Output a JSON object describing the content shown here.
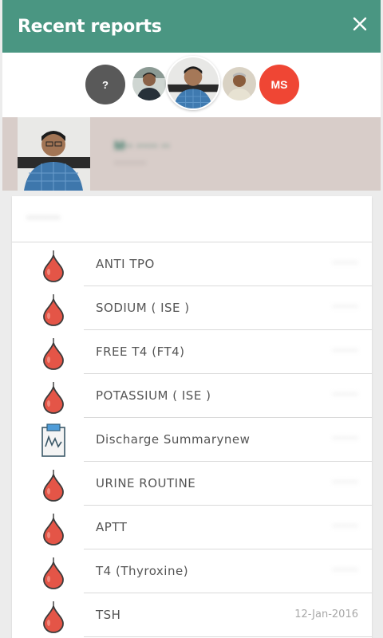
{
  "header": {
    "title": "Recent reports"
  },
  "avatars": [
    {
      "initials": "?",
      "color": "#595959"
    },
    {
      "initials": "",
      "color": "#6b7a80"
    },
    {
      "initials": "",
      "color": "#88aab6"
    },
    {
      "initials": "",
      "color": "#7d8480"
    },
    {
      "initials": "MS",
      "color": "#ef4634"
    }
  ],
  "profile": {
    "name": "M·· ····· ··",
    "sub": "········"
  },
  "card": {
    "group": "········"
  },
  "reports": [
    {
      "label": "ANTI TPO",
      "date": "········",
      "icon": "blood-drop-icon"
    },
    {
      "label": "SODIUM ( ISE )",
      "date": "········",
      "icon": "blood-drop-icon"
    },
    {
      "label": "FREE T4 (FT4)",
      "date": "········",
      "icon": "blood-drop-icon"
    },
    {
      "label": "POTASSIUM ( ISE )",
      "date": "········",
      "icon": "blood-drop-icon"
    },
    {
      "label": "Discharge Summarynew",
      "date": "········",
      "icon": "clipboard-chart-icon"
    },
    {
      "label": "URINE ROUTINE",
      "date": "········",
      "icon": "blood-drop-icon"
    },
    {
      "label": "APTT",
      "date": "········",
      "icon": "blood-drop-icon"
    },
    {
      "label": "T4 (Thyroxine)",
      "date": "········",
      "icon": "blood-drop-icon"
    },
    {
      "label": "TSH",
      "date": "12-Jan-2016",
      "icon": "blood-drop-icon"
    }
  ]
}
